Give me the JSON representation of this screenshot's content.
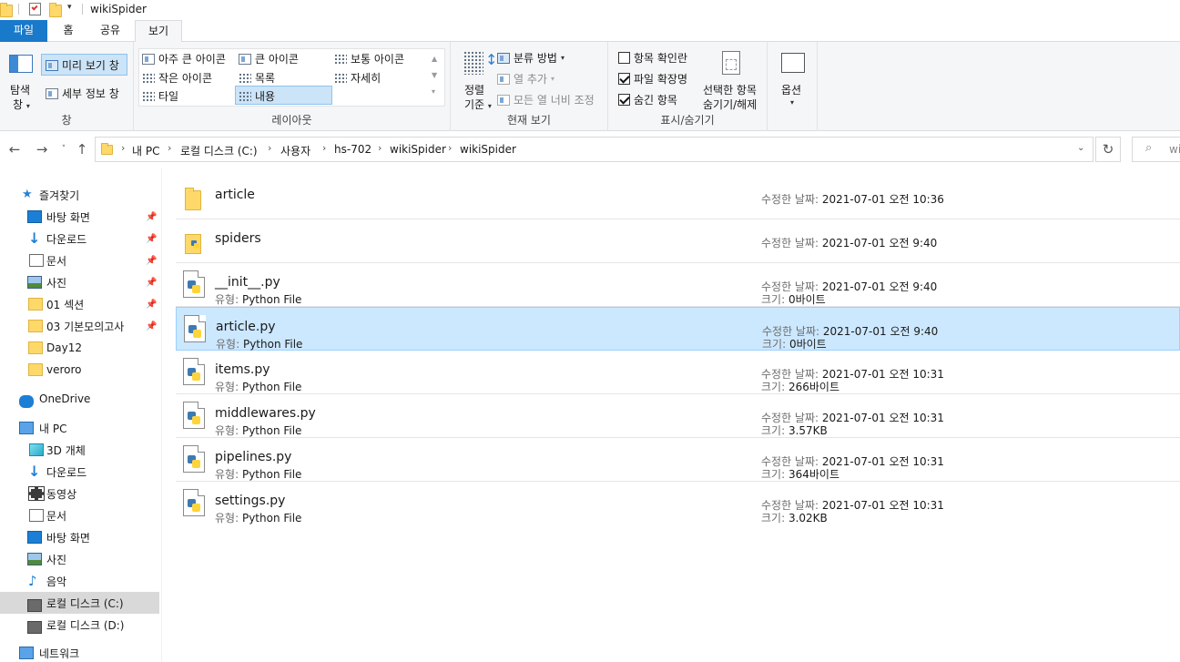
{
  "window": {
    "title": "wikiSpider"
  },
  "tabs": [
    {
      "label": "파일"
    },
    {
      "label": "홈"
    },
    {
      "label": "공유"
    },
    {
      "label": "보기"
    }
  ],
  "ribbon": {
    "pane": {
      "nav_pane": "탐색\n창",
      "nav_pane_l1": "탐색",
      "nav_pane_l2": "창",
      "preview_pane": "미리 보기 창",
      "details_pane": "세부 정보 창",
      "group_label": "창"
    },
    "layout": {
      "extra_large": "아주 큰 아이콘",
      "large": "큰 아이콘",
      "medium": "보통 아이콘",
      "small": "작은 아이콘",
      "list": "목록",
      "details": "자세히",
      "tiles": "타일",
      "content": "내용",
      "group_label": "레이아웃"
    },
    "current_view": {
      "sort_l1": "정렬",
      "sort_l2": "기준",
      "group_by": "분류 방법",
      "add_columns": "열 추가",
      "fit_columns": "모든 열 너비 조정",
      "group_label": "현재 보기"
    },
    "show_hide": {
      "item_checkboxes": "항목 확인란",
      "file_extensions": "파일 확장명",
      "hidden_items": "숨긴 항목",
      "hide_selected_l1": "선택한 항목",
      "hide_selected_l2": "숨기기/해제",
      "group_label": "표시/숨기기",
      "item_checkboxes_checked": false,
      "file_extensions_checked": true,
      "hidden_items_checked": true
    },
    "options": {
      "label": "옵션"
    }
  },
  "address": {
    "crumbs": [
      "내 PC",
      "로컬 디스크 (C:)",
      "사용자",
      "hs-702",
      "wikiSpider",
      "wikiSpider"
    ],
    "search_placeholder": "wi"
  },
  "sidebar": {
    "items": [
      {
        "label": "즐겨찾기",
        "icon": "star-icon"
      },
      {
        "label": "바탕 화면",
        "icon": "desktop-icon",
        "pinned": true
      },
      {
        "label": "다운로드",
        "icon": "download-icon",
        "pinned": true
      },
      {
        "label": "문서",
        "icon": "document-icon",
        "pinned": true
      },
      {
        "label": "사진",
        "icon": "pictures-icon",
        "pinned": true
      },
      {
        "label": "01 섹션",
        "icon": "folder-icon",
        "pinned": true
      },
      {
        "label": "03 기본모의고사",
        "icon": "folder-icon",
        "pinned": true
      },
      {
        "label": "Day12",
        "icon": "folder-icon"
      },
      {
        "label": "veroro",
        "icon": "folder-icon"
      },
      {
        "label": "OneDrive",
        "icon": "cloud-icon"
      },
      {
        "label": "내 PC",
        "icon": "pc-icon"
      },
      {
        "label": "3D 개체",
        "icon": "cube-icon"
      },
      {
        "label": "다운로드",
        "icon": "download-icon"
      },
      {
        "label": "동영상",
        "icon": "video-icon"
      },
      {
        "label": "문서",
        "icon": "document-icon"
      },
      {
        "label": "바탕 화면",
        "icon": "desktop-icon"
      },
      {
        "label": "사진",
        "icon": "pictures-icon"
      },
      {
        "label": "음악",
        "icon": "music-icon"
      },
      {
        "label": "로컬 디스크 (C:)",
        "icon": "drive-icon",
        "selected": true
      },
      {
        "label": "로컬 디스크 (D:)",
        "icon": "drive-icon"
      },
      {
        "label": "네트워크",
        "icon": "network-icon"
      }
    ]
  },
  "files": {
    "modified_label": "수정한 날짜:",
    "type_label": "유형:",
    "size_label": "크기:",
    "rows": [
      {
        "name": "article",
        "kind": "folder",
        "modified": "2021-07-01 오전 10:36"
      },
      {
        "name": "spiders",
        "kind": "py-folder",
        "modified": "2021-07-01 오전 9:40"
      },
      {
        "name": "__init__.py",
        "kind": "py",
        "type": "Python File",
        "modified": "2021-07-01 오전 9:40",
        "size": "0바이트"
      },
      {
        "name": "article.py",
        "kind": "py",
        "type": "Python File",
        "modified": "2021-07-01 오전 9:40",
        "size": "0바이트",
        "selected": true
      },
      {
        "name": "items.py",
        "kind": "py",
        "type": "Python File",
        "modified": "2021-07-01 오전 10:31",
        "size": "266바이트"
      },
      {
        "name": "middlewares.py",
        "kind": "py",
        "type": "Python File",
        "modified": "2021-07-01 오전 10:31",
        "size": "3.57KB"
      },
      {
        "name": "pipelines.py",
        "kind": "py",
        "type": "Python File",
        "modified": "2021-07-01 오전 10:31",
        "size": "364바이트"
      },
      {
        "name": "settings.py",
        "kind": "py",
        "type": "Python File",
        "modified": "2021-07-01 오전 10:31",
        "size": "3.02KB"
      }
    ]
  }
}
